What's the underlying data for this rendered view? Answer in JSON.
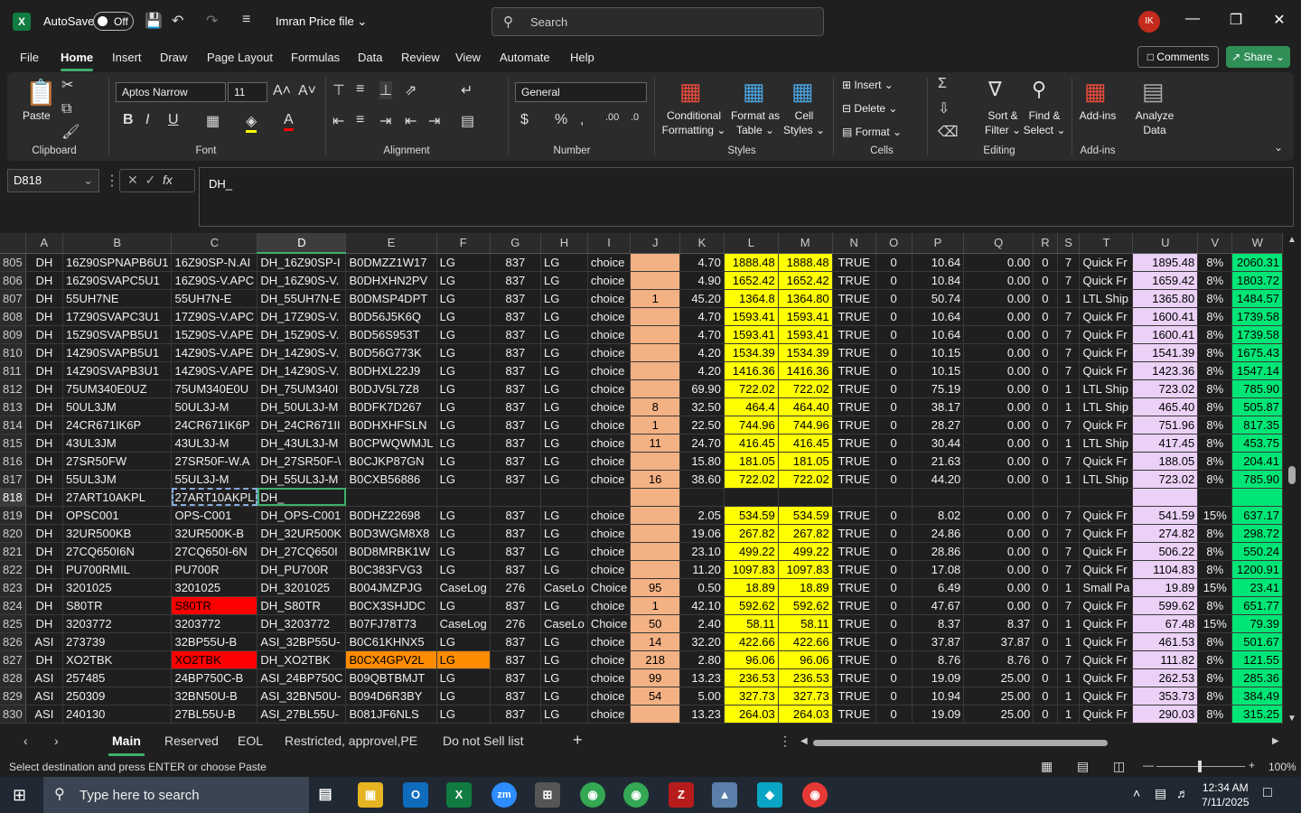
{
  "titlebar": {
    "autosave_label": "AutoSave",
    "toggle_state": "Off",
    "filename": "Imran Price file",
    "search_placeholder": "Search",
    "avatar_initials": "IK"
  },
  "menu": [
    "File",
    "Home",
    "Insert",
    "Draw",
    "Page Layout",
    "Formulas",
    "Data",
    "Review",
    "View",
    "Automate",
    "Help"
  ],
  "menu_active": "Home",
  "buttons": {
    "comments": "Comments",
    "share": "Share"
  },
  "ribbon": {
    "clipboard": {
      "label": "Clipboard",
      "paste": "Paste"
    },
    "font": {
      "label": "Font",
      "family": "Aptos Narrow",
      "size": "11"
    },
    "alignment": {
      "label": "Alignment"
    },
    "number": {
      "label": "Number",
      "format": "General"
    },
    "styles": {
      "label": "Styles",
      "conditional": "Conditional",
      "formatting": "Formatting",
      "format_as": "Format as",
      "table": "Table",
      "cell": "Cell",
      "cell_styles": "Styles"
    },
    "cells": {
      "label": "Cells",
      "insert": "Insert",
      "delete": "Delete",
      "format": "Format"
    },
    "editing": {
      "label": "Editing",
      "sort": "Sort &",
      "filter": "Filter",
      "find": "Find &",
      "select": "Select"
    },
    "addins": {
      "label": "Add-ins",
      "addins": "Add-ins",
      "analyze": "Analyze",
      "data": "Data"
    }
  },
  "formula_bar": {
    "name_box": "D818",
    "formula": "DH_"
  },
  "columns": [
    "A",
    "B",
    "C",
    "D",
    "E",
    "F",
    "G",
    "H",
    "I",
    "J",
    "K",
    "L",
    "M",
    "N",
    "O",
    "P",
    "Q",
    "R",
    "S",
    "T",
    "U",
    "V",
    "W"
  ],
  "selected_column": "D",
  "rows": [
    {
      "n": "805",
      "c": [
        "DH",
        "16Z90SPNAPB6U1",
        "16Z90SP-N.AI",
        "DH_16Z90SP-I",
        "B0DMZZ1W17",
        "LG",
        "837",
        "LG",
        "choice",
        "",
        "4.70",
        "1888.48",
        "1888.48",
        "TRUE",
        "0",
        "10.64",
        "0.00",
        "0",
        "7",
        "Quick Fr",
        "1895.48",
        "8%",
        "2060.31"
      ]
    },
    {
      "n": "806",
      "c": [
        "DH",
        "16Z90SVAPC5U1",
        "16Z90S-V.APC",
        "DH_16Z90S-V.",
        "B0DHXHN2PV",
        "LG",
        "837",
        "LG",
        "choice",
        "",
        "4.90",
        "1652.42",
        "1652.42",
        "TRUE",
        "0",
        "10.84",
        "0.00",
        "0",
        "7",
        "Quick Fr",
        "1659.42",
        "8%",
        "1803.72"
      ]
    },
    {
      "n": "807",
      "c": [
        "DH",
        "55UH7NE",
        "55UH7N-E",
        "DH_55UH7N-E",
        "B0DMSP4DPT",
        "LG",
        "837",
        "LG",
        "choice",
        "1",
        "45.20",
        "1364.8",
        "1364.80",
        "TRUE",
        "0",
        "50.74",
        "0.00",
        "0",
        "1",
        "LTL Ship",
        "1365.80",
        "8%",
        "1484.57"
      ]
    },
    {
      "n": "808",
      "c": [
        "DH",
        "17Z90SVAPC3U1",
        "17Z90S-V.APC",
        "DH_17Z90S-V.",
        "B0D56J5K6Q",
        "LG",
        "837",
        "LG",
        "choice",
        "",
        "4.70",
        "1593.41",
        "1593.41",
        "TRUE",
        "0",
        "10.64",
        "0.00",
        "0",
        "7",
        "Quick Fr",
        "1600.41",
        "8%",
        "1739.58"
      ]
    },
    {
      "n": "809",
      "c": [
        "DH",
        "15Z90SVAPB5U1",
        "15Z90S-V.APE",
        "DH_15Z90S-V.",
        "B0D56S953T",
        "LG",
        "837",
        "LG",
        "choice",
        "",
        "4.70",
        "1593.41",
        "1593.41",
        "TRUE",
        "0",
        "10.64",
        "0.00",
        "0",
        "7",
        "Quick Fr",
        "1600.41",
        "8%",
        "1739.58"
      ]
    },
    {
      "n": "810",
      "c": [
        "DH",
        "14Z90SVAPB5U1",
        "14Z90S-V.APE",
        "DH_14Z90S-V.",
        "B0D56G773K",
        "LG",
        "837",
        "LG",
        "choice",
        "",
        "4.20",
        "1534.39",
        "1534.39",
        "TRUE",
        "0",
        "10.15",
        "0.00",
        "0",
        "7",
        "Quick Fr",
        "1541.39",
        "8%",
        "1675.43"
      ]
    },
    {
      "n": "811",
      "c": [
        "DH",
        "14Z90SVAPB3U1",
        "14Z90S-V.APE",
        "DH_14Z90S-V.",
        "B0DHXL22J9",
        "LG",
        "837",
        "LG",
        "choice",
        "",
        "4.20",
        "1416.36",
        "1416.36",
        "TRUE",
        "0",
        "10.15",
        "0.00",
        "0",
        "7",
        "Quick Fr",
        "1423.36",
        "8%",
        "1547.14"
      ]
    },
    {
      "n": "812",
      "c": [
        "DH",
        "75UM340E0UZ",
        "75UM340E0U",
        "DH_75UM340I",
        "B0DJV5L7Z8",
        "LG",
        "837",
        "LG",
        "choice",
        "",
        "69.90",
        "722.02",
        "722.02",
        "TRUE",
        "0",
        "75.19",
        "0.00",
        "0",
        "1",
        "LTL Ship",
        "723.02",
        "8%",
        "785.90"
      ]
    },
    {
      "n": "813",
      "c": [
        "DH",
        "50UL3JM",
        "50UL3J-M",
        "DH_50UL3J-M",
        "B0DFK7D267",
        "LG",
        "837",
        "LG",
        "choice",
        "8",
        "32.50",
        "464.4",
        "464.40",
        "TRUE",
        "0",
        "38.17",
        "0.00",
        "0",
        "1",
        "LTL Ship",
        "465.40",
        "8%",
        "505.87"
      ]
    },
    {
      "n": "814",
      "c": [
        "DH",
        "24CR671IK6P",
        "24CR671IK6P",
        "DH_24CR671II",
        "B0DHXHFSLN",
        "LG",
        "837",
        "LG",
        "choice",
        "1",
        "22.50",
        "744.96",
        "744.96",
        "TRUE",
        "0",
        "28.27",
        "0.00",
        "0",
        "7",
        "Quick Fr",
        "751.96",
        "8%",
        "817.35"
      ]
    },
    {
      "n": "815",
      "c": [
        "DH",
        "43UL3JM",
        "43UL3J-M",
        "DH_43UL3J-M",
        "B0CPWQWMJL",
        "LG",
        "837",
        "LG",
        "choice",
        "11",
        "24.70",
        "416.45",
        "416.45",
        "TRUE",
        "0",
        "30.44",
        "0.00",
        "0",
        "1",
        "LTL Ship",
        "417.45",
        "8%",
        "453.75"
      ]
    },
    {
      "n": "816",
      "c": [
        "DH",
        "27SR50FW",
        "27SR50F-W.A",
        "DH_27SR50F-\\",
        "B0CJKP87GN",
        "LG",
        "837",
        "LG",
        "choice",
        "",
        "15.80",
        "181.05",
        "181.05",
        "TRUE",
        "0",
        "21.63",
        "0.00",
        "0",
        "7",
        "Quick Fr",
        "188.05",
        "8%",
        "204.41"
      ]
    },
    {
      "n": "817",
      "c": [
        "DH",
        "55UL3JM",
        "55UL3J-M",
        "DH_55UL3J-M",
        "B0CXB56886",
        "LG",
        "837",
        "LG",
        "choice",
        "16",
        "38.60",
        "722.02",
        "722.02",
        "TRUE",
        "0",
        "44.20",
        "0.00",
        "0",
        "1",
        "LTL Ship",
        "723.02",
        "8%",
        "785.90"
      ]
    },
    {
      "n": "818",
      "c": [
        "DH",
        "27ART10AKPL",
        "27ART10AKPL",
        "DH_",
        "",
        "",
        "",
        "",
        "",
        "",
        "",
        "",
        "",
        "",
        "",
        "",
        "",
        "",
        "",
        "",
        "",
        "",
        ""
      ]
    },
    {
      "n": "819",
      "c": [
        "DH",
        "OPSC001",
        "OPS-C001",
        "DH_OPS-C001",
        "B0DHZ22698",
        "LG",
        "837",
        "LG",
        "choice",
        "",
        "2.05",
        "534.59",
        "534.59",
        "TRUE",
        "0",
        "8.02",
        "0.00",
        "0",
        "7",
        "Quick Fr",
        "541.59",
        "15%",
        "637.17"
      ]
    },
    {
      "n": "820",
      "c": [
        "DH",
        "32UR500KB",
        "32UR500K-B",
        "DH_32UR500K",
        "B0D3WGM8X8",
        "LG",
        "837",
        "LG",
        "choice",
        "",
        "19.06",
        "267.82",
        "267.82",
        "TRUE",
        "0",
        "24.86",
        "0.00",
        "0",
        "7",
        "Quick Fr",
        "274.82",
        "8%",
        "298.72"
      ]
    },
    {
      "n": "821",
      "c": [
        "DH",
        "27CQ650I6N",
        "27CQ650I-6N",
        "DH_27CQ650I",
        "B0D8MRBK1W",
        "LG",
        "837",
        "LG",
        "choice",
        "",
        "23.10",
        "499.22",
        "499.22",
        "TRUE",
        "0",
        "28.86",
        "0.00",
        "0",
        "7",
        "Quick Fr",
        "506.22",
        "8%",
        "550.24"
      ]
    },
    {
      "n": "822",
      "c": [
        "DH",
        "PU700RMIL",
        "PU700R",
        "DH_PU700R",
        "B0C383FVG3",
        "LG",
        "837",
        "LG",
        "choice",
        "",
        "11.20",
        "1097.83",
        "1097.83",
        "TRUE",
        "0",
        "17.08",
        "0.00",
        "0",
        "7",
        "Quick Fr",
        "1104.83",
        "8%",
        "1200.91"
      ]
    },
    {
      "n": "823",
      "c": [
        "DH",
        "3201025",
        "3201025",
        "DH_3201025",
        "B004JMZPJG",
        "CaseLog",
        "276",
        "CaseLo",
        "Choice",
        "95",
        "0.50",
        "18.89",
        "18.89",
        "TRUE",
        "0",
        "6.49",
        "0.00",
        "0",
        "1",
        "Small Pa",
        "19.89",
        "15%",
        "23.41"
      ]
    },
    {
      "n": "824",
      "c": [
        "DH",
        "S80TR",
        "S80TR",
        "DH_S80TR",
        "B0CX3SHJDC",
        "LG",
        "837",
        "LG",
        "choice",
        "1",
        "42.10",
        "592.62",
        "592.62",
        "TRUE",
        "0",
        "47.67",
        "0.00",
        "0",
        "7",
        "Quick Fr",
        "599.62",
        "8%",
        "651.77"
      ]
    },
    {
      "n": "825",
      "c": [
        "DH",
        "3203772",
        "3203772",
        "DH_3203772",
        "B07FJ78T73",
        "CaseLog",
        "276",
        "CaseLo",
        "Choice",
        "50",
        "2.40",
        "58.11",
        "58.11",
        "TRUE",
        "0",
        "8.37",
        "8.37",
        "0",
        "1",
        "Quick Fr",
        "67.48",
        "15%",
        "79.39"
      ]
    },
    {
      "n": "826",
      "c": [
        "ASI",
        "273739",
        "32BP55U-B",
        "ASI_32BP55U-",
        "B0C61KHNX5",
        "LG",
        "837",
        "LG",
        "choice",
        "14",
        "32.20",
        "422.66",
        "422.66",
        "TRUE",
        "0",
        "37.87",
        "37.87",
        "0",
        "1",
        "Quick Fr",
        "461.53",
        "8%",
        "501.67"
      ]
    },
    {
      "n": "827",
      "c": [
        "DH",
        "XO2TBK",
        "XO2TBK",
        "DH_XO2TBK",
        "B0CX4GPV2L",
        "LG",
        "837",
        "LG",
        "choice",
        "218",
        "2.80",
        "96.06",
        "96.06",
        "TRUE",
        "0",
        "8.76",
        "8.76",
        "0",
        "7",
        "Quick Fr",
        "111.82",
        "8%",
        "121.55"
      ]
    },
    {
      "n": "828",
      "c": [
        "ASI",
        "257485",
        "24BP750C-B",
        "ASI_24BP750C",
        "B09QBTBMJT",
        "LG",
        "837",
        "LG",
        "choice",
        "99",
        "13.23",
        "236.53",
        "236.53",
        "TRUE",
        "0",
        "19.09",
        "25.00",
        "0",
        "1",
        "Quick Fr",
        "262.53",
        "8%",
        "285.36"
      ]
    },
    {
      "n": "829",
      "c": [
        "ASI",
        "250309",
        "32BN50U-B",
        "ASI_32BN50U-",
        "B094D6R3BY",
        "LG",
        "837",
        "LG",
        "choice",
        "54",
        "5.00",
        "327.73",
        "327.73",
        "TRUE",
        "0",
        "10.94",
        "25.00",
        "0",
        "1",
        "Quick Fr",
        "353.73",
        "8%",
        "384.49"
      ]
    },
    {
      "n": "830",
      "c": [
        "ASI",
        "240130",
        "27BL55U-B",
        "ASI_27BL55U-",
        "B081JF6NLS",
        "LG",
        "837",
        "LG",
        "choice",
        "",
        "13.23",
        "264.03",
        "264.03",
        "TRUE",
        "0",
        "19.09",
        "25.00",
        "0",
        "1",
        "Quick Fr",
        "290.03",
        "8%",
        "315.25"
      ]
    }
  ],
  "sheet_tabs": [
    "Main",
    "Reserved",
    "EOL",
    "Restricted, approvel,PE",
    "Do not Sell list"
  ],
  "active_tab": "Main",
  "status": {
    "message": "Select destination and press ENTER or choose Paste",
    "zoom": "100%"
  },
  "taskbar": {
    "search_placeholder": "Type here to search",
    "time": "12:34 AM",
    "date": "7/11/2025"
  },
  "colors": {
    "accent": "#3fae6a",
    "excel_green": "#107c41",
    "pink": "#f4b183",
    "yellow": "#ffff00",
    "lavender": "#ead1f5",
    "green": "#00e676",
    "red": "#ff0000",
    "orange": "#ff8c00"
  }
}
